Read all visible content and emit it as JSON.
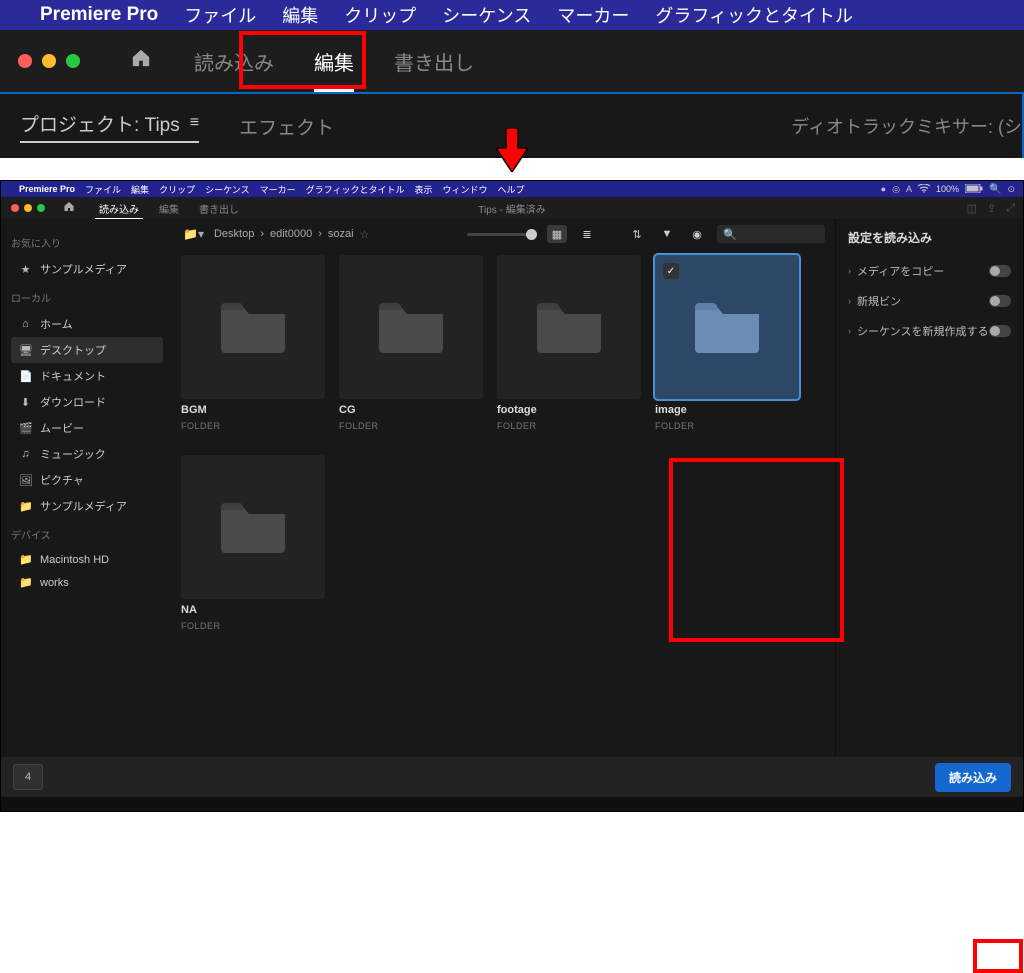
{
  "top": {
    "menubar": {
      "app": "Premiere Pro",
      "items": [
        "ファイル",
        "編集",
        "クリップ",
        "シーケンス",
        "マーカー",
        "グラフィックとタイトル"
      ]
    },
    "tabs": {
      "import": "読み込み",
      "edit": "編集",
      "export": "書き出し"
    },
    "project_label": "プロジェクト: Tips",
    "effects_label": "エフェクト",
    "mixer_label": "ディオトラックミキサー: (シ"
  },
  "bot": {
    "menubar": {
      "app": "Premiere Pro",
      "items": [
        "ファイル",
        "編集",
        "クリップ",
        "シーケンス",
        "マーカー",
        "グラフィックとタイトル",
        "表示",
        "ウィンドウ",
        "ヘルプ"
      ],
      "battery": "100%"
    },
    "tabs": {
      "import": "読み込み",
      "edit": "編集",
      "export": "書き出し"
    },
    "doc_title": "Tips - 編集済み",
    "sidebar": {
      "fav_head": "お気に入り",
      "fav": [
        {
          "icon": "★",
          "label": "サンプルメディア"
        }
      ],
      "loc_head": "ローカル",
      "loc": [
        {
          "icon": "⌂",
          "label": "ホーム"
        },
        {
          "icon": "🖥",
          "label": "デスクトップ",
          "sel": true
        },
        {
          "icon": "📄",
          "label": "ドキュメント"
        },
        {
          "icon": "⬇",
          "label": "ダウンロード"
        },
        {
          "icon": "🎬",
          "label": "ムービー"
        },
        {
          "icon": "♫",
          "label": "ミュージック"
        },
        {
          "icon": "🖼",
          "label": "ピクチャ"
        },
        {
          "icon": "📁",
          "label": "サンプルメディア"
        }
      ],
      "dev_head": "デバイス",
      "dev": [
        {
          "icon": "📁",
          "label": "Macintosh HD"
        },
        {
          "icon": "📁",
          "label": "works"
        }
      ]
    },
    "path": [
      "Desktop",
      "edit0000",
      "sozai"
    ],
    "folders": [
      {
        "name": "BGM",
        "kind": "FOLDER"
      },
      {
        "name": "CG",
        "kind": "FOLDER"
      },
      {
        "name": "footage",
        "kind": "FOLDER"
      },
      {
        "name": "image",
        "kind": "FOLDER",
        "selected": true
      },
      {
        "name": "NA",
        "kind": "FOLDER"
      }
    ],
    "right": {
      "title": "設定を読み込み",
      "rows": [
        "メディアをコピー",
        "新規ビン",
        "シーケンスを新規作成する"
      ]
    },
    "sel_count": "4",
    "import_btn": "読み込み"
  }
}
